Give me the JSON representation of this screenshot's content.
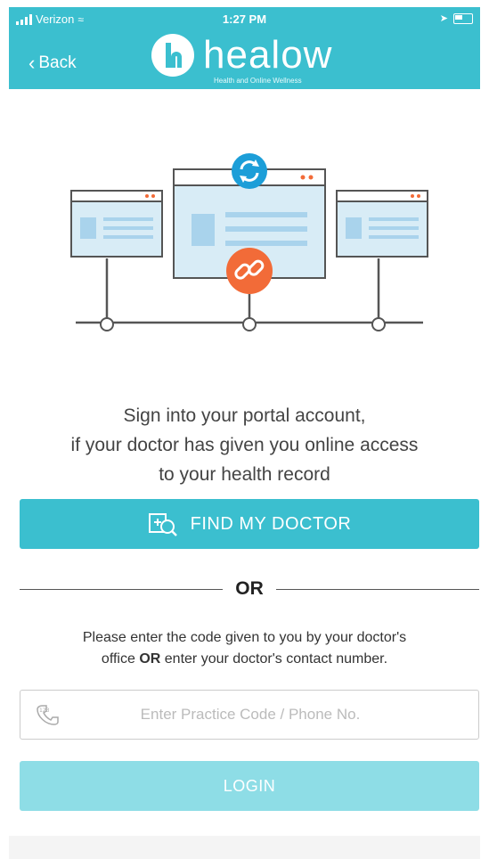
{
  "status_bar": {
    "carrier": "Verizon",
    "time": "1:27 PM"
  },
  "header": {
    "back_label": "Back",
    "logo_word": "healow",
    "logo_tagline": "Health and Online Wellness"
  },
  "intro": {
    "line1": "Sign into your portal account,",
    "line2": "if your doctor has given you online access",
    "line3": "to your health record"
  },
  "find_doctor": {
    "label": "FIND MY DOCTOR",
    "icon": "doctor-search-icon"
  },
  "divider": {
    "label": "OR"
  },
  "instructions": {
    "part1": "Please enter the code given to you by your doctor's",
    "part2": "office ",
    "bold": "OR",
    "part3": " enter your doctor's contact number."
  },
  "code_input": {
    "value": "",
    "placeholder": "Enter Practice Code / Phone No.",
    "icon": "phone-handset-icon"
  },
  "login": {
    "label": "LOGIN"
  },
  "colors": {
    "brand": "#3bbfcf",
    "login_disabled": "#8edde6",
    "accent_orange": "#f26b38",
    "sync_blue": "#1c9ed8"
  }
}
